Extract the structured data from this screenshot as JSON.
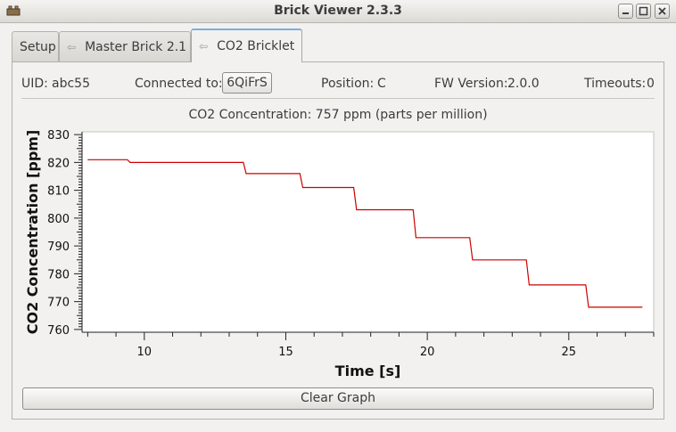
{
  "window": {
    "title": "Brick Viewer 2.3.3",
    "minimize_icon": "minimize-icon",
    "maximize_icon": "maximize-icon",
    "close_icon": "close-icon"
  },
  "tabs": [
    {
      "label": "Setup",
      "icon": "",
      "active": false
    },
    {
      "label": "Master Brick 2.1",
      "icon": "detach-icon",
      "active": false
    },
    {
      "label": "CO2 Bricklet",
      "icon": "detach-icon",
      "active": true
    }
  ],
  "info": {
    "uid_label": "UID:",
    "uid_value": "abc55",
    "connected_label": "Connected to:",
    "connected_value": "6QiFrS",
    "position_label": "Position:",
    "position_value": "C",
    "fw_label": "FW Version:",
    "fw_value": "2.0.0",
    "timeouts_label": "Timeouts:",
    "timeouts_value": "0"
  },
  "plot_label": "CO2 Concentration: 757 ppm (parts per million)",
  "chart_data": {
    "type": "line",
    "xlabel": "Time [s]",
    "ylabel": "CO2 Concentration [ppm]",
    "xlim": [
      7.8,
      28.0
    ],
    "ylim": [
      759,
      831
    ],
    "xticks": [
      10,
      15,
      20,
      25
    ],
    "yticks": [
      760,
      770,
      780,
      790,
      800,
      810,
      820,
      830
    ],
    "grid": false,
    "line_color": "#cc0000",
    "series": [
      {
        "values": [
          [
            8.0,
            821
          ],
          [
            9.4,
            821
          ],
          [
            9.5,
            820
          ],
          [
            13.5,
            820
          ],
          [
            13.6,
            816
          ],
          [
            15.5,
            816
          ],
          [
            15.6,
            811
          ],
          [
            17.4,
            811
          ],
          [
            17.5,
            803
          ],
          [
            19.5,
            803
          ],
          [
            19.6,
            793
          ],
          [
            21.5,
            793
          ],
          [
            21.6,
            785
          ],
          [
            23.5,
            785
          ],
          [
            23.6,
            776
          ],
          [
            25.6,
            776
          ],
          [
            25.7,
            768
          ],
          [
            27.6,
            768
          ]
        ]
      }
    ]
  },
  "clear_button": "Clear Graph"
}
